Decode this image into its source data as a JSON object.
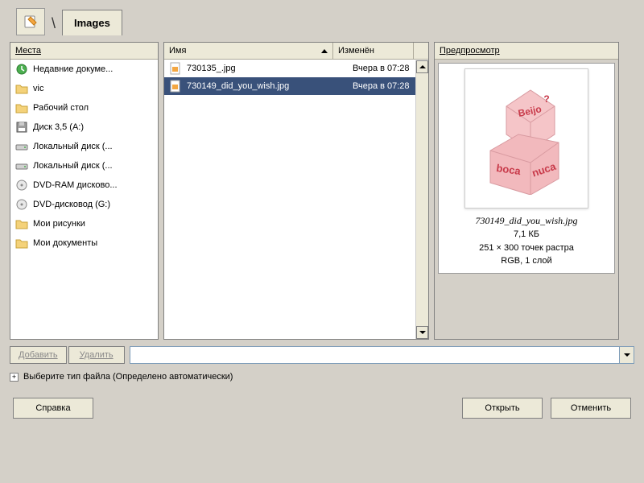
{
  "tab": {
    "label": "Images"
  },
  "places": {
    "title": "Места",
    "items": [
      {
        "label": "Недавние докуме...",
        "icon": "recent"
      },
      {
        "label": "vic",
        "icon": "folder"
      },
      {
        "label": "Рабочий стол",
        "icon": "folder"
      },
      {
        "label": "Диск 3,5 (A:)",
        "icon": "floppy"
      },
      {
        "label": "Локальный диск (...",
        "icon": "drive"
      },
      {
        "label": "Локальный диск (...",
        "icon": "drive"
      },
      {
        "label": "DVD-RAM дисково...",
        "icon": "optical"
      },
      {
        "label": "DVD-дисковод (G:)",
        "icon": "optical"
      },
      {
        "label": "Мои рисунки",
        "icon": "folder"
      },
      {
        "label": "Мои документы",
        "icon": "folder"
      }
    ]
  },
  "files": {
    "columns": {
      "name": "Имя",
      "modified": "Изменён"
    },
    "rows": [
      {
        "name": "730135_.jpg",
        "modified": "Вчера в 07:28",
        "selected": false
      },
      {
        "name": "730149_did_you_wish.jpg",
        "modified": "Вчера в 07:28",
        "selected": true
      }
    ]
  },
  "preview": {
    "title": "Предпросмотр",
    "filename": "730149_did_you_wish.jpg",
    "size": "7,1 КБ",
    "dims": "251 × 300 точек растра",
    "mode": "RGB, 1 слой"
  },
  "buttons": {
    "add": "Добавить",
    "delete": "Удалить",
    "help": "Справка",
    "open": "Открыть",
    "cancel": "Отменить"
  },
  "filetype": {
    "label": "Выберите тип файла (Определено автоматически)"
  }
}
